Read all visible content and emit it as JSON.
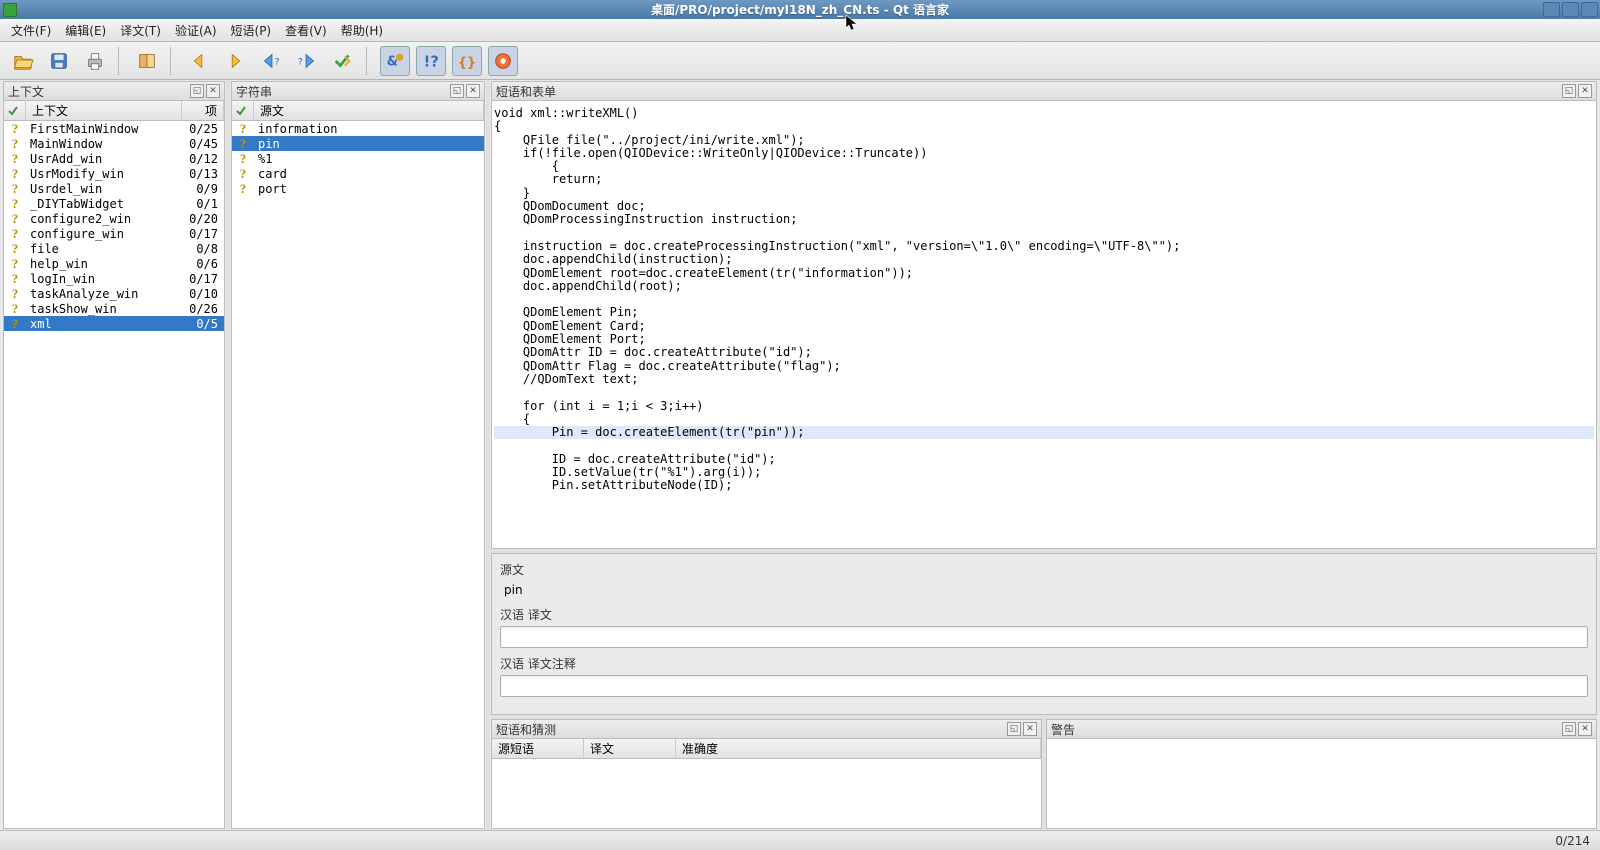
{
  "window": {
    "title": "桌面/PRO/project/myI18N_zh_CN.ts - Qt 语言家"
  },
  "menu": [
    {
      "label": "文件(F)",
      "key": "file"
    },
    {
      "label": "编辑(E)",
      "key": "edit"
    },
    {
      "label": "译文(T)",
      "key": "translate"
    },
    {
      "label": "验证(A)",
      "key": "validate"
    },
    {
      "label": "短语(P)",
      "key": "phrase"
    },
    {
      "label": "查看(V)",
      "key": "view"
    },
    {
      "label": "帮助(H)",
      "key": "help"
    }
  ],
  "panels": {
    "context": {
      "title": "上下文",
      "col1": "上下文",
      "col2": "项"
    },
    "strings": {
      "title": "字符串",
      "col1": "源文"
    },
    "sourceform": {
      "title": "短语和表单"
    },
    "phrases_guesses": {
      "title": "短语和猜测",
      "col1": "源短语",
      "col2": "译文",
      "col3": "准确度"
    },
    "warnings": {
      "title": "警告"
    }
  },
  "contexts": [
    {
      "name": "FirstMainWindow",
      "done": 0,
      "total": 25
    },
    {
      "name": "MainWindow",
      "done": 0,
      "total": 45
    },
    {
      "name": "UsrAdd_win",
      "done": 0,
      "total": 12
    },
    {
      "name": "UsrModify_win",
      "done": 0,
      "total": 13
    },
    {
      "name": "Usrdel_win",
      "done": 0,
      "total": 9
    },
    {
      "name": "_DIYTabWidget",
      "done": 0,
      "total": 1
    },
    {
      "name": "configure2_win",
      "done": 0,
      "total": 20
    },
    {
      "name": "configure_win",
      "done": 0,
      "total": 17
    },
    {
      "name": "file",
      "done": 0,
      "total": 8
    },
    {
      "name": "help_win",
      "done": 0,
      "total": 6
    },
    {
      "name": "logIn_win",
      "done": 0,
      "total": 17
    },
    {
      "name": "taskAnalyze_win",
      "done": 0,
      "total": 10
    },
    {
      "name": "taskShow_win",
      "done": 0,
      "total": 26
    },
    {
      "name": "xml",
      "done": 0,
      "total": 5,
      "selected": true
    }
  ],
  "strings": [
    {
      "text": "information"
    },
    {
      "text": "pin",
      "selected": true
    },
    {
      "text": "%1"
    },
    {
      "text": "card"
    },
    {
      "text": "port"
    }
  ],
  "code": {
    "pre": "void xml::writeXML()\n{\n    QFile file(\"../project/ini/write.xml\");\n    if(!file.open(QIODevice::WriteOnly|QIODevice::Truncate))\n        {\n        return;\n    }\n    QDomDocument doc;\n    QDomProcessingInstruction instruction;\n\n    instruction = doc.createProcessingInstruction(\"xml\", \"version=\\\"1.0\\\" encoding=\\\"UTF-8\\\"\");\n    doc.appendChild(instruction);\n    QDomElement root=doc.createElement(tr(\"information\"));\n    doc.appendChild(root);\n\n    QDomElement Pin;\n    QDomElement Card;\n    QDomElement Port;\n    QDomAttr ID = doc.createAttribute(\"id\");\n    QDomAttr Flag = doc.createAttribute(\"flag\");\n    //QDomText text;\n\n    for (int i = 1;i < 3;i++)\n    {",
    "hl": "        Pin = doc.createElement(tr(\"pin\"));",
    "post": "\n        ID = doc.createAttribute(\"id\");\n        ID.setValue(tr(\"%1\").arg(i));\n        Pin.setAttributeNode(ID);"
  },
  "form": {
    "source_label": "源文",
    "source_value": "pin",
    "translation_label": "汉语 译文",
    "translation_value": "",
    "comment_label": "汉语 译文注释",
    "comment_value": ""
  },
  "status": {
    "progress": "0/214"
  }
}
